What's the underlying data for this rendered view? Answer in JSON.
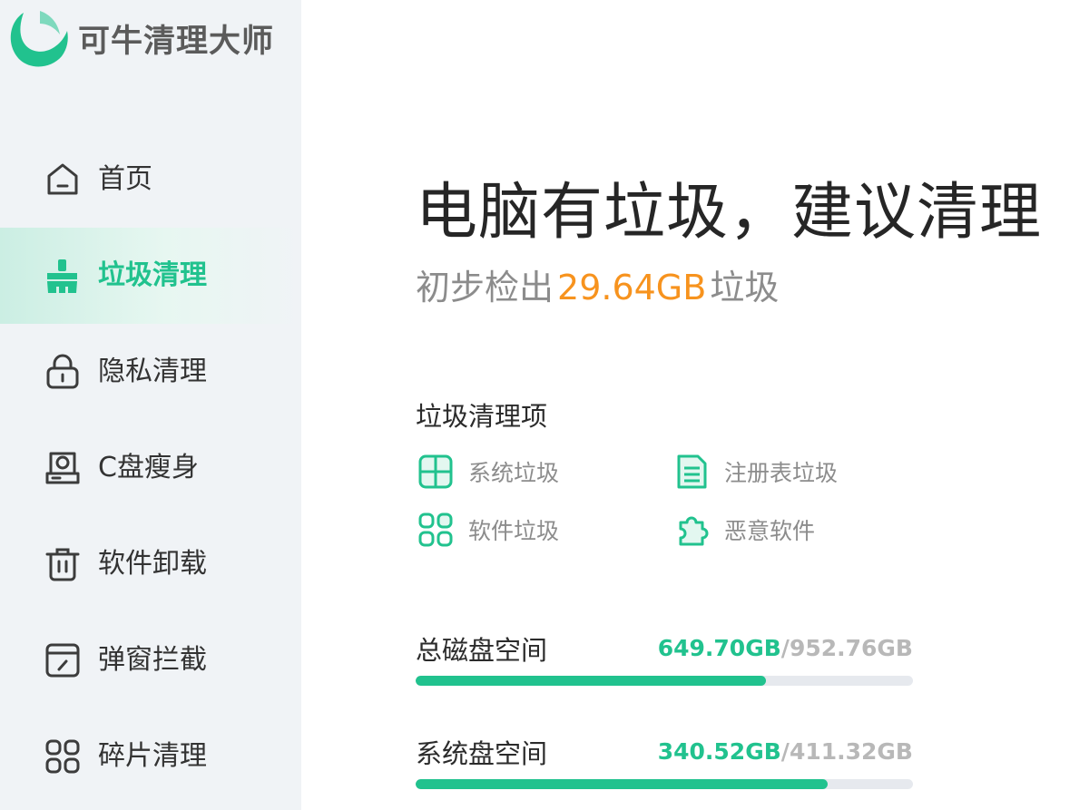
{
  "app": {
    "name": "可牛清理大师",
    "accent_color": "#21c28e",
    "highlight_color": "#f7931e"
  },
  "sidebar": {
    "items": [
      {
        "label": "首页",
        "icon": "home-icon",
        "active": false
      },
      {
        "label": "垃圾清理",
        "icon": "broom-icon",
        "active": true
      },
      {
        "label": "隐私清理",
        "icon": "lock-icon",
        "active": false
      },
      {
        "label": "C盘瘦身",
        "icon": "disk-icon",
        "active": false
      },
      {
        "label": "软件卸载",
        "icon": "trash-icon",
        "active": false
      },
      {
        "label": "弹窗拦截",
        "icon": "popup-block-icon",
        "active": false
      },
      {
        "label": "碎片清理",
        "icon": "grid-icon",
        "active": false
      }
    ]
  },
  "main": {
    "headline": "电脑有垃圾，建议清理",
    "sub_prefix": "初步检出",
    "sub_amount": "29.64GB",
    "sub_suffix": "垃圾",
    "section_title": "垃圾清理项",
    "clean_items": [
      {
        "label": "系统垃圾",
        "icon": "windows-icon"
      },
      {
        "label": "注册表垃圾",
        "icon": "document-icon"
      },
      {
        "label": "软件垃圾",
        "icon": "apps-icon"
      },
      {
        "label": "恶意软件",
        "icon": "puzzle-icon"
      }
    ],
    "disks": [
      {
        "label": "总磁盘空间",
        "used": "649.70GB",
        "separator": "/",
        "total": "952.76GB",
        "fraction": 0.7052
      },
      {
        "label": "系统盘空间",
        "used": "340.52GB",
        "separator": "/",
        "total": "411.32GB",
        "fraction": 0.8279
      }
    ]
  }
}
